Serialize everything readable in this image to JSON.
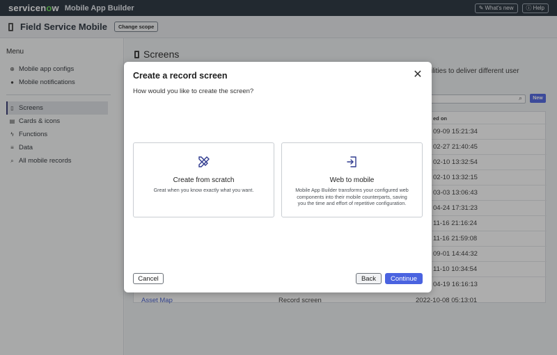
{
  "topbar": {
    "logo_text_a": "servicen",
    "logo_text_o": "o",
    "logo_text_b": "w",
    "product_name": "Mobile App Builder",
    "whats_new_label": "What's new",
    "help_label": "Help"
  },
  "scope": {
    "title": "Field Service Mobile",
    "change_scope_label": "Change scope"
  },
  "sidebar": {
    "menu_label": "Menu",
    "group1": [
      {
        "icon": "globe-icon",
        "glyph": "⊕",
        "label": "Mobile app configs"
      },
      {
        "icon": "bell-icon",
        "glyph": "●",
        "label": "Mobile notifications"
      }
    ],
    "group2": [
      {
        "icon": "phone-icon",
        "glyph": "▯",
        "label": "Screens",
        "active": true
      },
      {
        "icon": "card-icon",
        "glyph": "▤",
        "label": "Cards & icons"
      },
      {
        "icon": "function-icon",
        "glyph": "ϟ",
        "label": "Functions"
      },
      {
        "icon": "database-icon",
        "glyph": "≡",
        "label": "Data"
      },
      {
        "icon": "search-icon",
        "glyph": "⌕",
        "label": "All mobile records"
      }
    ]
  },
  "main": {
    "title": "Screens",
    "description_partial": "ilities to deliver different user",
    "new_button_label": "New",
    "column_header_partial": "ed on",
    "dates": [
      "09-09 15:21:34",
      "02-27 21:40:45",
      "02-10 13:32:54",
      "02-10 13:32:15",
      "03-03 13:06:43",
      "04-24 17:31:23",
      "11-16 21:16:24",
      "11-16 21:59:08",
      "09-01 14:44:32",
      "11-10 10:34:54",
      "04-19 16:16:13"
    ],
    "last_row": {
      "name": "Asset Map",
      "type": "Record screen",
      "date": "2022-10-08 05:13:01"
    }
  },
  "modal": {
    "title": "Create a record screen",
    "subtitle": "How would you like to create the screen?",
    "option_scratch": {
      "icon": "tools-icon",
      "title": "Create from scratch",
      "description": "Great when you know exactly what you want."
    },
    "option_web": {
      "icon": "import-icon",
      "title": "Web to mobile",
      "description": "Mobile App Builder transforms your configured web components into their mobile counterparts, saving you the time and effort of repetitive configuration."
    },
    "cancel_label": "Cancel",
    "back_label": "Back",
    "continue_label": "Continue"
  },
  "colors": {
    "topbar_bg": "#1f2a36",
    "accent": "#4a63e0",
    "logo_green": "#62d84e",
    "link": "#3a55c9"
  }
}
